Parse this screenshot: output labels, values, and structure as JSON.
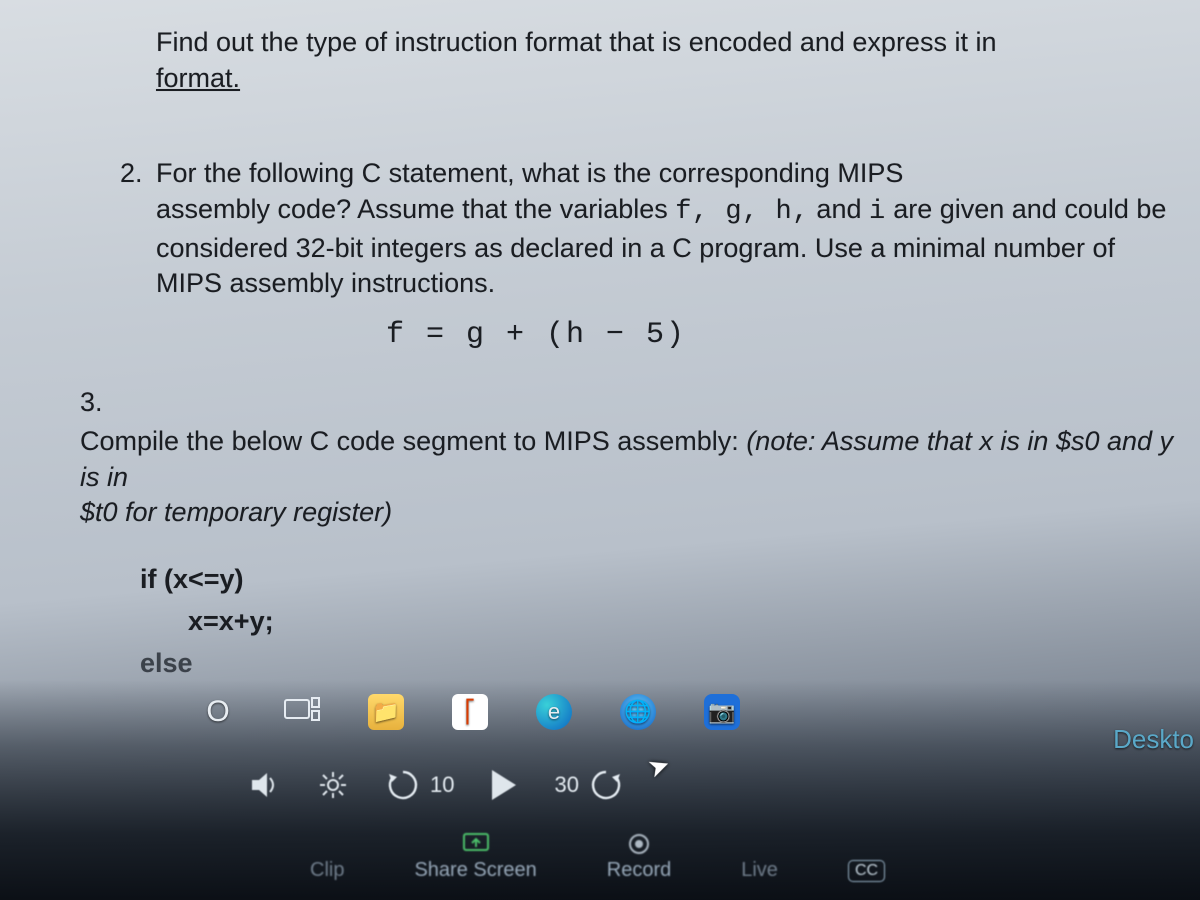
{
  "intro": {
    "line1_prefix": "Find out the type of instruction format that is encoded and express it in",
    "line2_underlined": "format."
  },
  "q2": {
    "number": "2.",
    "text_a": "For the following C statement, what is the corresponding MIPS",
    "text_b_prefix": "assembly code? Assume that the variables ",
    "vars": "f,  g,  h,",
    "text_b_mid": "  and ",
    "var_i": "i",
    "text_b_suffix": "  are given and could be",
    "text_c": "considered 32-bit integers as declared in a C program. Use a minimal number of",
    "text_d": "MIPS assembly instructions.",
    "formula": "f = g +  (h − 5)"
  },
  "q3": {
    "number": "3.",
    "text_a_prefix": "Compile the below C code segment to MIPS assembly: ",
    "note_open": "(note: Assume that x is in $s0 and y is in",
    "text_b": "$t0 for temporary register)",
    "code_if": "if (x<=y)",
    "code_then": "x=x+y;",
    "code_else": "else"
  },
  "taskbar": {
    "cortana": "O",
    "desktop_label": "Deskto"
  },
  "video_controls": {
    "back_seconds": "10",
    "forward_seconds": "30",
    "share_label": "Share Screen",
    "record_label": "Record",
    "cc_label": "CC",
    "clip_label": "Clip",
    "live_label": "Live"
  }
}
